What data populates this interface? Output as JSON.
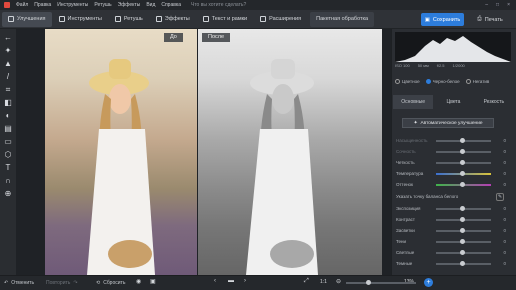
{
  "menu": {
    "items": [
      "Файл",
      "Правка",
      "Инструменты",
      "Ретушь",
      "Эффекты",
      "Вид",
      "Справка"
    ],
    "hint": "Что вы хотите сделать?"
  },
  "toolbar": {
    "tabs": [
      "Улучшения",
      "Инструменты",
      "Ретушь",
      "Эффекты",
      "Текст и рамки",
      "Расширения"
    ],
    "panoramic": "Пакетная обработка",
    "save": "Сохранить",
    "print": "Печать"
  },
  "canvas": {
    "before_label": "До",
    "after_label": "После"
  },
  "histogram": {
    "iso": "ISO 100",
    "focal": "50 мм",
    "aperture": "f/2.5",
    "shutter": "1/2000"
  },
  "panel": {
    "modes": [
      "Цветное",
      "Черно-белое",
      "Негатив"
    ],
    "selected_mode": "Черно-белое",
    "tabs": [
      "Основные",
      "Цвета",
      "Резкость"
    ],
    "active_tab": "Основные",
    "auto_button": "Автоматическое улучшение",
    "sliders_top": [
      {
        "name": "Насыщенность",
        "value": "0",
        "enabled": false
      },
      {
        "name": "Сочность",
        "value": "0",
        "enabled": false
      },
      {
        "name": "Четкость",
        "value": "0",
        "enabled": true
      },
      {
        "name": "Температура",
        "value": "0",
        "enabled": true
      },
      {
        "name": "Оттенок",
        "value": "0",
        "enabled": true
      }
    ],
    "white_balance": "Указать точку баланса белого",
    "sliders_bottom": [
      {
        "name": "Экспозиция",
        "value": "0"
      },
      {
        "name": "Контраст",
        "value": "0"
      },
      {
        "name": "Засветки",
        "value": "0"
      },
      {
        "name": "Тени",
        "value": "0"
      },
      {
        "name": "Светлые",
        "value": "0"
      },
      {
        "name": "Темные",
        "value": "0"
      }
    ]
  },
  "status": {
    "undo": "Отменить",
    "redo": "Повторить",
    "reset": "Сбросить",
    "ratio": "1:1",
    "zoom": "13%"
  },
  "colors": {
    "accent": "#2d7ddc"
  }
}
